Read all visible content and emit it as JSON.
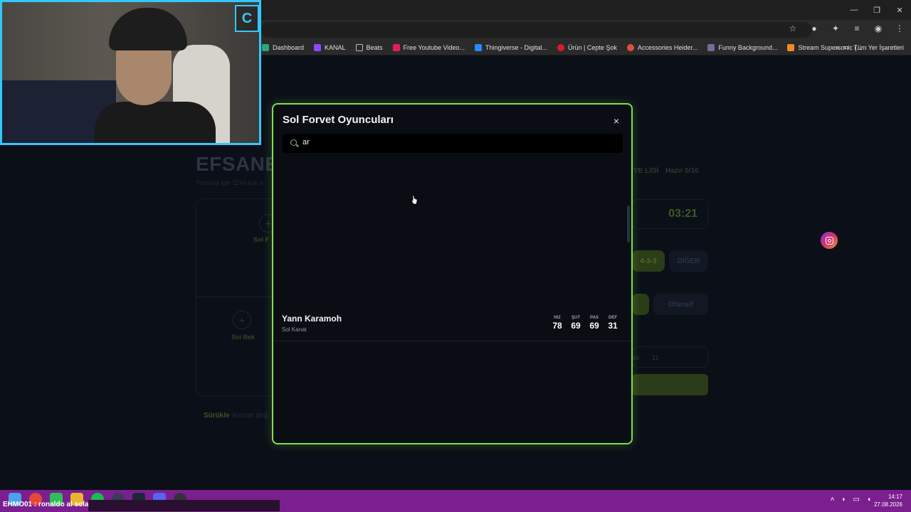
{
  "bookmarks": [
    {
      "label": "Dashboard",
      "color": "#2ea57a"
    },
    {
      "label": "KANAL",
      "color": "#9146ff"
    },
    {
      "label": "Beats",
      "color": "#777777"
    },
    {
      "label": "Free Youtube Video...",
      "color": "#e01e5a"
    },
    {
      "label": "Thingiverse - Digital...",
      "color": "#248bfb"
    },
    {
      "label": "Ürün | Cepte Şok",
      "color": "#d81b2b"
    },
    {
      "label": "Accessories Heider...",
      "color": "#e0513a"
    },
    {
      "label": "Funny Background...",
      "color": "#6e6e9e"
    },
    {
      "label": "Stream Supersonic (...",
      "color": "#f08a24"
    }
  ],
  "bookmarks_more": "»",
  "bookmarks_all": "Tüm Yer İşaretleri",
  "modal": {
    "title": "Sol Forvet Oyuncuları",
    "close": "×",
    "search_value": "ar",
    "player": {
      "name": "Yann Karamoh",
      "position": "Sol Kanat",
      "stats": [
        {
          "label": "HIZ",
          "value": "78"
        },
        {
          "label": "ŞUT",
          "value": "69"
        },
        {
          "label": "PAS",
          "value": "69"
        },
        {
          "label": "DEF",
          "value": "31"
        }
      ]
    }
  },
  "background": {
    "title": "EFSANE",
    "subtitle": "Turnuva için 11'ini kur, s",
    "slot1": "Sol F",
    "slot2": "Sol Bek",
    "league": "YE LİGİ",
    "ready": "Hazır 0/16",
    "timer": "03:21",
    "formation": "4-3-3",
    "other": "DİĞER",
    "offensive": "Ofansif",
    "strip_a": "ss",
    "strip_b": "11",
    "drag_bold": "Sürükle",
    "drag_text": "konum değ"
  },
  "taskbar": {
    "user": "EHMO01",
    "message": ": ronaldo al sola",
    "time": "14:17",
    "date": "27.08.2026"
  }
}
